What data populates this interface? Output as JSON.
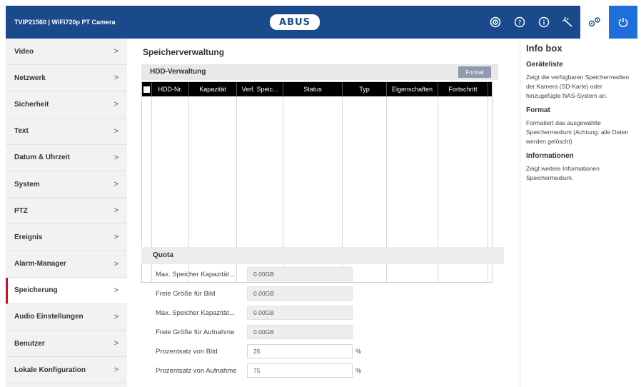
{
  "header": {
    "title": "TVIP21560 | WiFi720p PT Camera",
    "logo": "ABUS",
    "icons": [
      "live-view-icon",
      "help-icon",
      "info-icon",
      "config-wand-icon",
      "settings-icon",
      "power-icon"
    ]
  },
  "sidebar": {
    "items": [
      {
        "label": "Video"
      },
      {
        "label": "Netzwerk"
      },
      {
        "label": "Sicherheit"
      },
      {
        "label": "Text"
      },
      {
        "label": "Datum & Uhrzeit"
      },
      {
        "label": "System"
      },
      {
        "label": "PTZ"
      },
      {
        "label": "Ereignis"
      },
      {
        "label": "Alarm-Manager"
      },
      {
        "label": "Speicherung"
      },
      {
        "label": "Audio Einstellungen"
      },
      {
        "label": "Benutzer"
      },
      {
        "label": "Lokale Konfiguration"
      }
    ],
    "active_index": 9,
    "chevron": ">"
  },
  "main": {
    "title": "Speicherverwaltung",
    "hdd_section": {
      "label": "HDD-Verwaltung",
      "format_button": "Format",
      "columns": [
        "HDD-Nr.",
        "Kapazität",
        "Verf. Speic...",
        "Status",
        "Typ",
        "Eigenschaften",
        "Fortschritt"
      ],
      "rows": []
    },
    "quota": {
      "label": "Quota",
      "fields": [
        {
          "label": "Max. Speicher Kapazität...",
          "value": "0.00GB",
          "unit": ""
        },
        {
          "label": "Freie Größe für Bild",
          "value": "0.00GB",
          "unit": ""
        },
        {
          "label": "Max. Speicher Kapazität...",
          "value": "0.00GB",
          "unit": ""
        },
        {
          "label": "Freie Größe für Aufnahme",
          "value": "0.00GB",
          "unit": ""
        },
        {
          "label": "Prozentsatz von Bild",
          "value": "25",
          "unit": "%"
        },
        {
          "label": "Prozentsatz von Aufnahme",
          "value": "75",
          "unit": "%"
        }
      ]
    }
  },
  "info_box": {
    "title": "Info box",
    "sections": [
      {
        "heading": "Geräteliste",
        "text": "Zeigt die verfügbaren Speichermedien der Kamera (SD-Karte) oder hinzugefügte NAS-System an."
      },
      {
        "heading": "Format",
        "text": "Formatiert das ausgewählte Speichermedium (Achtung: alle Daten werden gelöscht)"
      },
      {
        "heading": "Informationen",
        "text": "Zeigt weitere Informationen Speichermedium."
      }
    ]
  },
  "colors": {
    "header_bg": "#1a4a8c",
    "active_accent": "#c8102e",
    "power_bg": "#1e6fd9",
    "format_btn": "#8f99b0"
  }
}
